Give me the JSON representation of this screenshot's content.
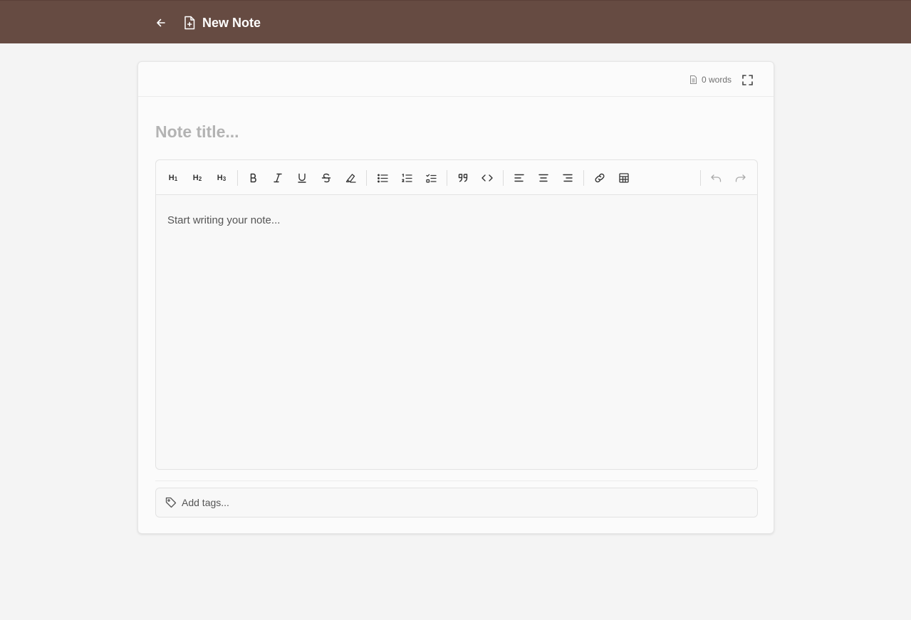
{
  "header": {
    "title": "New Note",
    "back_icon": "arrow-left-icon",
    "title_icon": "file-plus-icon",
    "background": "#664b42"
  },
  "editor": {
    "word_count": "0 words",
    "title_placeholder": "Note title...",
    "body_placeholder": "Start writing your note...",
    "tags_placeholder": "Add tags..."
  },
  "toolbar": {
    "heading_prefix": "H",
    "h1": "1",
    "h2": "2",
    "h3": "3",
    "tools": [
      "heading-1",
      "heading-2",
      "heading-3",
      "bold",
      "italic",
      "underline",
      "strikethrough",
      "highlight",
      "bullet-list",
      "ordered-list",
      "task-list",
      "blockquote",
      "code",
      "align-left",
      "align-center",
      "align-right",
      "link",
      "table",
      "undo",
      "redo"
    ]
  }
}
